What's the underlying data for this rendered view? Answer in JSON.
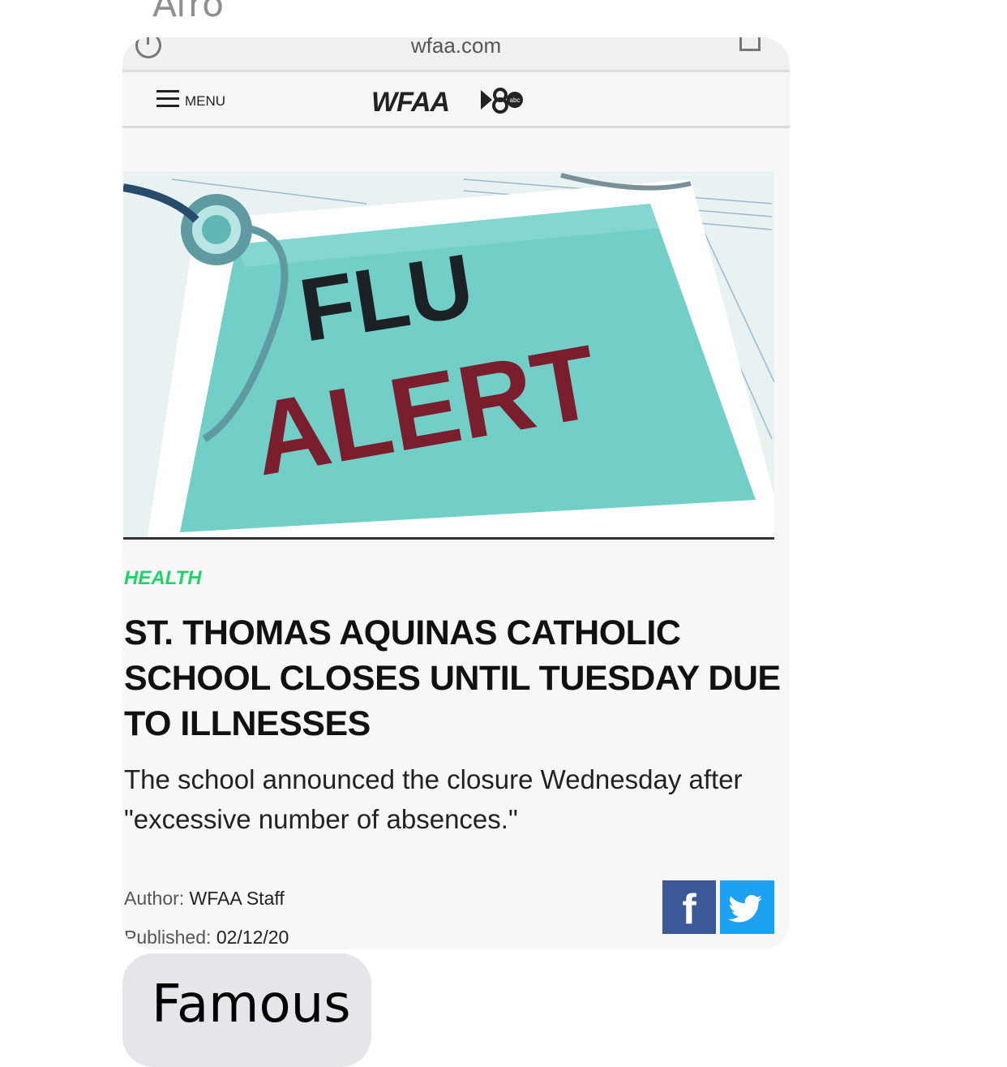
{
  "contact": {
    "name": "Afro"
  },
  "browser": {
    "url": "wfaa.com"
  },
  "site": {
    "menu_label": "MENU",
    "logo_text": "WFAA",
    "logo_badge": "abc"
  },
  "hero_image": {
    "line1": "FLU",
    "line2": "ALERT"
  },
  "article": {
    "category": "HEALTH",
    "headline": "ST. THOMAS AQUINAS CATHOLIC SCHOOL CLOSES UNTIL TUESDAY DUE TO ILLNESSES",
    "summary": "The school announced the closure Wednesday after \"excessive number of absences.\"",
    "author_label": "Author:",
    "author": "WFAA Staff",
    "published_label": "Published:",
    "published_date": "02/12/20"
  },
  "share": {
    "facebook_glyph": "f",
    "twitter_icon": "twitter-icon"
  },
  "message": {
    "text": "Famous"
  },
  "colors": {
    "category": "#1fd36a",
    "facebook": "#3b5998",
    "twitter": "#1da1f2",
    "bubble": "#e5e5ea"
  }
}
